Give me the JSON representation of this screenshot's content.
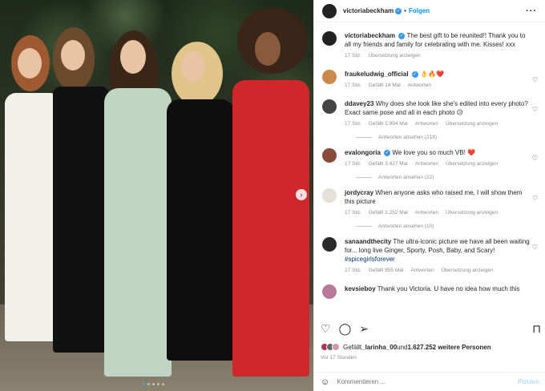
{
  "post": {
    "username": "victoriabeckham",
    "follow_label": "Folgen",
    "separator": "•",
    "more_label": "···"
  },
  "caption": {
    "username": "victoriabeckham",
    "text": "The best gift to be reunited!! Thank you to all my friends and family for celebrating with me. Kisses! xxx",
    "time": "17 Std.",
    "translate": "Übersetzung anzeigen"
  },
  "comments": [
    {
      "username": "fraukeludwig_official",
      "text": "👌🔥❤️",
      "time": "17 Std.",
      "likes": "Gefällt 14 Mal",
      "reply": "Antworten",
      "translate": "",
      "verified": true
    },
    {
      "username": "ddavey23",
      "text": "Why does she look like she's edited into every photo? Exact same pose and all in each photo 😥",
      "time": "17 Std.",
      "likes": "Gefällt 5.994 Mal",
      "reply": "Antworten",
      "translate": "Übersetzung anzeigen",
      "replies": "Antworten ansehen (218)",
      "verified": false
    },
    {
      "username": "evalongoria",
      "text": "We love you so much VB! ❤️",
      "time": "17 Std.",
      "likes": "Gefällt 3.427 Mal",
      "reply": "Antworten",
      "translate": "Übersetzung anzeigen",
      "replies": "Antworten ansehen (22)",
      "verified": true
    },
    {
      "username": "jordycray",
      "text": "When anyone asks who raised me, I will show them this picture",
      "time": "17 Std.",
      "likes": "Gefällt 1.252 Mal",
      "reply": "Antworten",
      "translate": "Übersetzung anzeigen",
      "replies": "Antworten ansehen (10)",
      "verified": false
    },
    {
      "username": "sanaandthecity",
      "text": "The ultra-iconic picture we have all been waiting for... long live Ginger, Sporty, Posh, Baby, and Scary!",
      "hashtag": "#spicegirlsforever",
      "time": "17 Std.",
      "likes": "Gefällt 855 Mal",
      "reply": "Antworten",
      "translate": "Übersetzung anzeigen",
      "verified": false
    },
    {
      "username": "kevsieboy",
      "text": "Thank you Victoria. U have no idea how much this",
      "verified": false
    }
  ],
  "likes_line": {
    "prefix": "Gefällt ",
    "user": "_larinha_00",
    "middle": " und ",
    "count": "1.627.252 weitere Personen"
  },
  "date": "Vor 17 Stunden",
  "comment_box": {
    "placeholder": "Kommentieren ...",
    "post_label": "Posten"
  },
  "icons": {
    "like": "heart-icon",
    "comment": "comment-icon",
    "share": "share-icon",
    "save": "bookmark-icon",
    "next": "chevron-right-icon",
    "emoji": "emoji-icon"
  },
  "colors": {
    "accent": "#0095f6",
    "verified": "#3897f0",
    "muted": "#8e8e8e",
    "hashtag": "#00376b"
  }
}
